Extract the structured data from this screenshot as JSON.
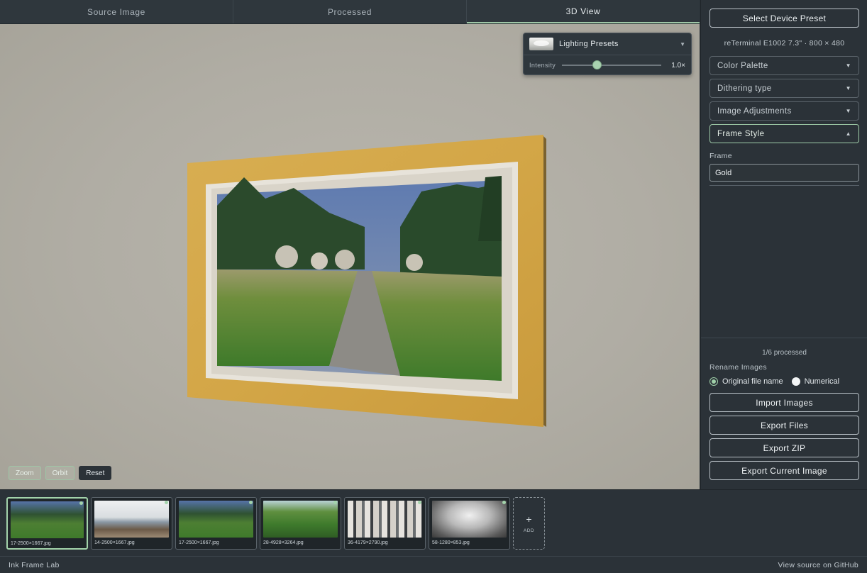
{
  "tabs": [
    {
      "label": "Source Image"
    },
    {
      "label": "Processed"
    },
    {
      "label": "3D View"
    }
  ],
  "active_tab": "3D View",
  "lighting": {
    "preset_label": "Lighting Presets",
    "intensity_label": "Intensity",
    "intensity_value": "1.0×",
    "intensity_fraction": 0.35
  },
  "view_controls": {
    "zoom": "Zoom",
    "orbit": "Orbit",
    "reset": "Reset"
  },
  "sidebar": {
    "device_preset_button": "Select Device Preset",
    "device_info": "reTerminal E1002 7.3\" · 800 × 480",
    "sections": [
      {
        "label": "Color Palette",
        "caret": "▼"
      },
      {
        "label": "Dithering type",
        "caret": "▼"
      },
      {
        "label": "Image Adjustments",
        "caret": "▼"
      },
      {
        "label": "Frame Style",
        "caret": "▲"
      }
    ],
    "frame_label": "Frame",
    "frame_value": "Gold",
    "processed_status": "1/6 processed",
    "rename_label": "Rename Images",
    "rename_options": [
      {
        "label": "Original file name",
        "selected": true
      },
      {
        "label": "Numerical",
        "selected": false
      }
    ],
    "actions": [
      {
        "label": "Import Images"
      },
      {
        "label": "Export Files"
      },
      {
        "label": "Export ZIP"
      },
      {
        "label": "Export Current Image"
      }
    ]
  },
  "thumbnails": [
    {
      "caption": "17-2500×1667.jpg",
      "kind": "path",
      "selected": true
    },
    {
      "caption": "14-2500×1667.jpg",
      "kind": "sea",
      "selected": false
    },
    {
      "caption": "17-2500×1667.jpg",
      "kind": "path",
      "selected": false
    },
    {
      "caption": "28-4928×3264.jpg",
      "kind": "forest",
      "selected": false
    },
    {
      "caption": "36-4179×2790.jpg",
      "kind": "flatlay",
      "selected": false
    },
    {
      "caption": "58-1280×853.jpg",
      "kind": "lighthouse",
      "selected": false
    }
  ],
  "add_tile_label": "ADD",
  "footer": {
    "app_name": "Ink Frame Lab",
    "source_link": "View source on GitHub"
  },
  "colors": {
    "accent": "#a3d3ab",
    "frame_gold": "#d4a84a",
    "mat": "#e8e4dc"
  }
}
